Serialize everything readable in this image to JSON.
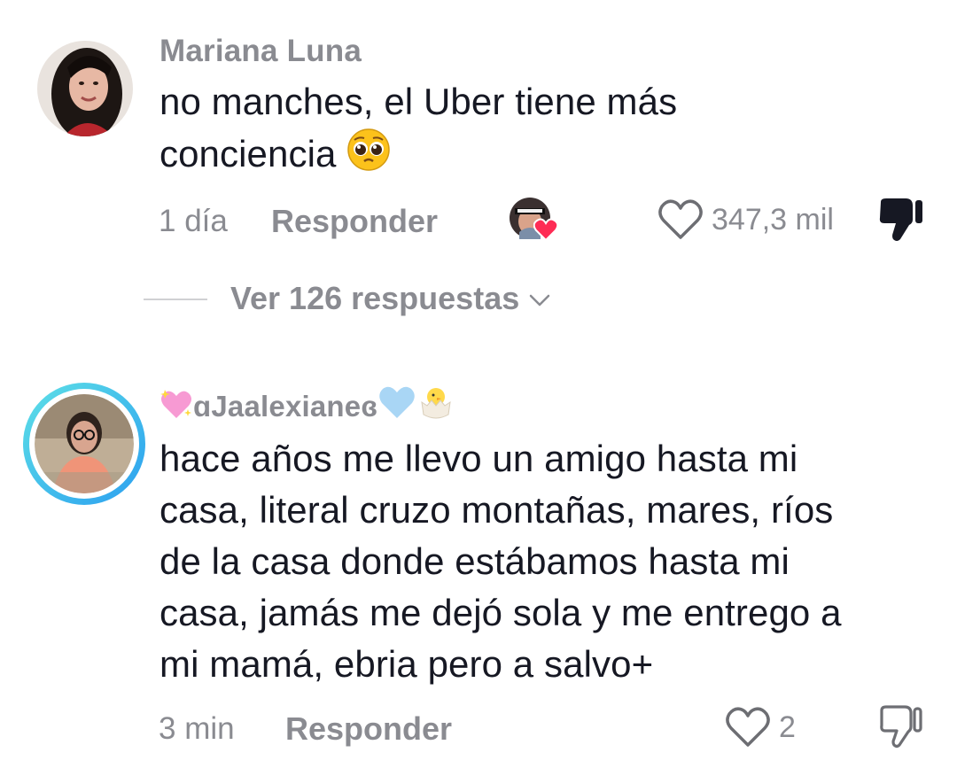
{
  "comments": [
    {
      "username": "Mariana Luna",
      "text_line1": "no manches, el Uber tiene más",
      "text_line2": "conciencia",
      "text_emoji": "pleading-face-emoji",
      "time": "1 día",
      "reply_label": "Responder",
      "likes": "347,3 mil",
      "creator_liked": true,
      "disliked": true,
      "replies_toggle": "Ver 126 respuestas"
    },
    {
      "username": "ɑJaalexianeɞ",
      "username_prefix_icon": "sparkling-heart-emoji",
      "username_suffix_icons": [
        "light-blue-heart-emoji",
        "hatching-chick-emoji"
      ],
      "avatar_ring": true,
      "text_lines": [
        "hace años me llevo un amigo hasta mi",
        "casa, literal cruzo montañas, mares, ríos",
        "de la casa donde estábamos hasta mi",
        "casa, jamás me dejó sola y me entrego a",
        "mi mamá, ebria pero a salvo+"
      ],
      "time": "3 min",
      "reply_label": "Responder",
      "likes": "2",
      "disliked": false
    }
  ],
  "colors": {
    "text_primary": "#161823",
    "text_secondary": "#8a8b91",
    "heart_red": "#fe2c55",
    "ring_start": "#5ee0e6",
    "ring_end": "#2b9ff0"
  }
}
